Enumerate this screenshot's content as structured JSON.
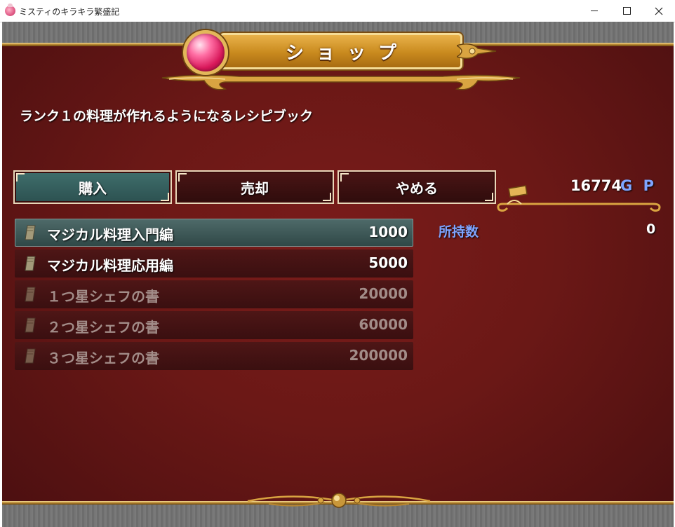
{
  "window": {
    "title": "ミスティのキラキラ繁盛記",
    "controls": {
      "minimize": "minimize",
      "maximize": "maximize",
      "close": "close"
    }
  },
  "shop": {
    "title": "ショップ",
    "description": "ランク１の料理が作れるようになるレシピブック",
    "commands": [
      {
        "label": "購入",
        "selected": true
      },
      {
        "label": "売却",
        "selected": false
      },
      {
        "label": "やめる",
        "selected": false
      }
    ],
    "gold": {
      "value": "16774",
      "unit": "G P"
    },
    "possession": {
      "label": "所持数",
      "value": "0"
    },
    "items": [
      {
        "name": "マジカル料理入門編",
        "price": "1000",
        "state": "selected"
      },
      {
        "name": "マジカル料理応用編",
        "price": "5000",
        "state": "enabled"
      },
      {
        "name": "１つ星シェフの書",
        "price": "20000",
        "state": "disabled"
      },
      {
        "name": "２つ星シェフの書",
        "price": "60000",
        "state": "disabled"
      },
      {
        "name": "３つ星シェフの書",
        "price": "200000",
        "state": "disabled"
      }
    ]
  },
  "colors": {
    "background": "#6b1816",
    "gold_trim": "#d9a441",
    "accent_blue": "#7fa4ff",
    "selected_row": "#3f5f5e"
  },
  "icons": {
    "item": "book-icon",
    "gem": "pink-gem-icon"
  }
}
